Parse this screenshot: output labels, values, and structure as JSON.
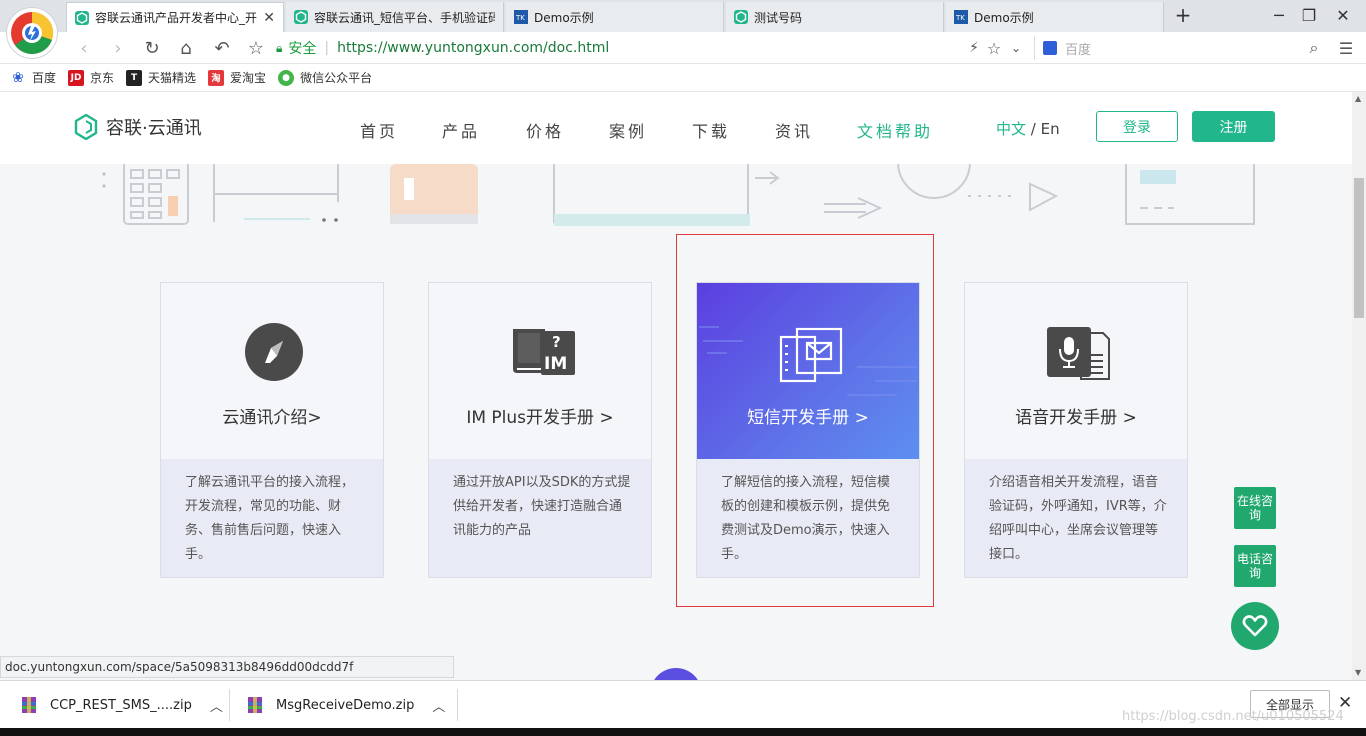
{
  "browser": {
    "tabs": [
      {
        "title": "容联云通讯产品开发者中心_开",
        "active": true
      },
      {
        "title": "容联云通讯_短信平台、手机验证码",
        "active": false
      },
      {
        "title": "Demo示例",
        "active": false
      },
      {
        "title": "测试号码",
        "active": false
      },
      {
        "title": "Demo示例",
        "active": false
      }
    ],
    "new_tab": "+",
    "secure_label": "安全",
    "url": "https://www.yuntongxun.com/doc.html",
    "search_placeholder": "百度",
    "bookmarks": [
      {
        "label": "百度",
        "icon": "baidu-paw-icon",
        "color": "#2f5fd8"
      },
      {
        "label": "京东",
        "icon": "jd-icon",
        "color": "#d7141f",
        "badge": "JD"
      },
      {
        "label": "天猫精选",
        "icon": "tmall-icon",
        "color": "#222222",
        "badge": "T"
      },
      {
        "label": "爱淘宝",
        "icon": "taobao-icon",
        "color": "#e4393c",
        "badge": "淘"
      },
      {
        "label": "微信公众平台",
        "icon": "wechat-icon",
        "color": "#44b549"
      }
    ]
  },
  "site": {
    "brand": "容联·云通讯",
    "menu": [
      "首页",
      "产品",
      "价格",
      "案例",
      "下载",
      "资讯",
      "文档帮助"
    ],
    "active_menu": "文档帮助",
    "lang_zh": "中文",
    "lang_sep": "/",
    "lang_en": "En",
    "login": "登录",
    "register": "注册",
    "accent_color": "#21b68b"
  },
  "cards": [
    {
      "title": "云通讯介绍>",
      "icon": "compass-icon",
      "desc": "了解云通讯平台的接入流程，开发流程，常见的功能、财务、售前售后问题，快速入手。"
    },
    {
      "title": "IM Plus开发手册 >",
      "icon": "im-book-icon",
      "desc": "通过开放API以及SDK的方式提供给开发者，快速打造融合通讯能力的产品"
    },
    {
      "title": "短信开发手册 >",
      "icon": "sms-doc-icon",
      "desc": "了解短信的接入流程，短信模板的创建和模板示例，提供免费测试及Demo演示，快速入手。",
      "highlighted": true
    },
    {
      "title": "语音开发手册 >",
      "icon": "microphone-doc-icon",
      "desc": "介绍语音相关开发流程，语音验证码，外呼通知，IVR等，介绍呼叫中心，坐席会议管理等接口。"
    }
  ],
  "side": {
    "online": "在线咨询",
    "phone": "电话咨询"
  },
  "status_url": "doc.yuntongxun.com/space/5a5098313b8496dd00dcdd7f",
  "downloads": [
    {
      "name": "CCP_REST_SMS_....zip"
    },
    {
      "name": "MsgReceiveDemo.zip"
    }
  ],
  "show_all": "全部显示",
  "watermark": "https://blog.csdn.net/u010505524"
}
